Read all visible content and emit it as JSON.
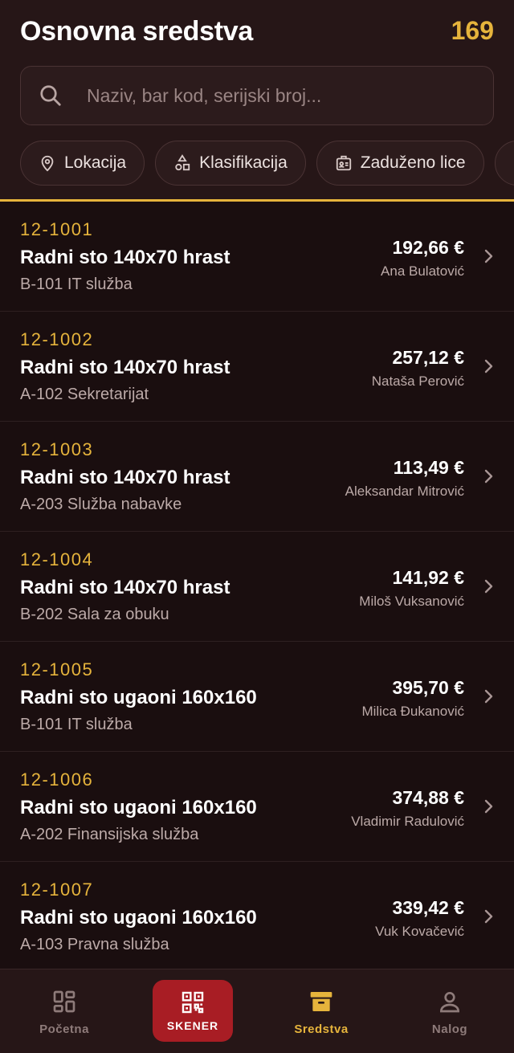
{
  "header": {
    "title": "Osnovna sredstva",
    "count": "169"
  },
  "search": {
    "placeholder": "Naziv, bar kod, serijski broj..."
  },
  "filters": [
    {
      "label": "Lokacija",
      "icon": "location-pin-icon"
    },
    {
      "label": "Klasifikacija",
      "icon": "shapes-icon"
    },
    {
      "label": "Zaduženo lice",
      "icon": "id-badge-icon"
    }
  ],
  "assets": [
    {
      "code": "12-1001",
      "name": "Radni sto 140x70 hrast",
      "location": "B-101 IT služba",
      "price": "192,66 €",
      "person": "Ana Bulatović"
    },
    {
      "code": "12-1002",
      "name": "Radni sto 140x70 hrast",
      "location": "A-102 Sekretarijat",
      "price": "257,12 €",
      "person": "Nataša Perović"
    },
    {
      "code": "12-1003",
      "name": "Radni sto 140x70 hrast",
      "location": "A-203 Služba nabavke",
      "price": "113,49 €",
      "person": "Aleksandar Mitrović"
    },
    {
      "code": "12-1004",
      "name": "Radni sto 140x70 hrast",
      "location": "B-202 Sala za obuku",
      "price": "141,92 €",
      "person": "Miloš Vuksanović"
    },
    {
      "code": "12-1005",
      "name": "Radni sto ugaoni 160x160",
      "location": "B-101 IT služba",
      "price": "395,70 €",
      "person": "Milica Đukanović"
    },
    {
      "code": "12-1006",
      "name": "Radni sto ugaoni 160x160",
      "location": "A-202 Finansijska služba",
      "price": "374,88 €",
      "person": "Vladimir Radulović"
    },
    {
      "code": "12-1007",
      "name": "Radni sto ugaoni 160x160",
      "location": "A-103 Pravna služba",
      "price": "339,42 €",
      "person": "Vuk Kovačević"
    }
  ],
  "nav": {
    "home": "Početna",
    "scanner": "SKENER",
    "assets": "Sredstva",
    "account": "Nalog"
  },
  "colors": {
    "accent": "#e6b43c",
    "scanner": "#a81d24",
    "background": "#1a0e0f"
  }
}
